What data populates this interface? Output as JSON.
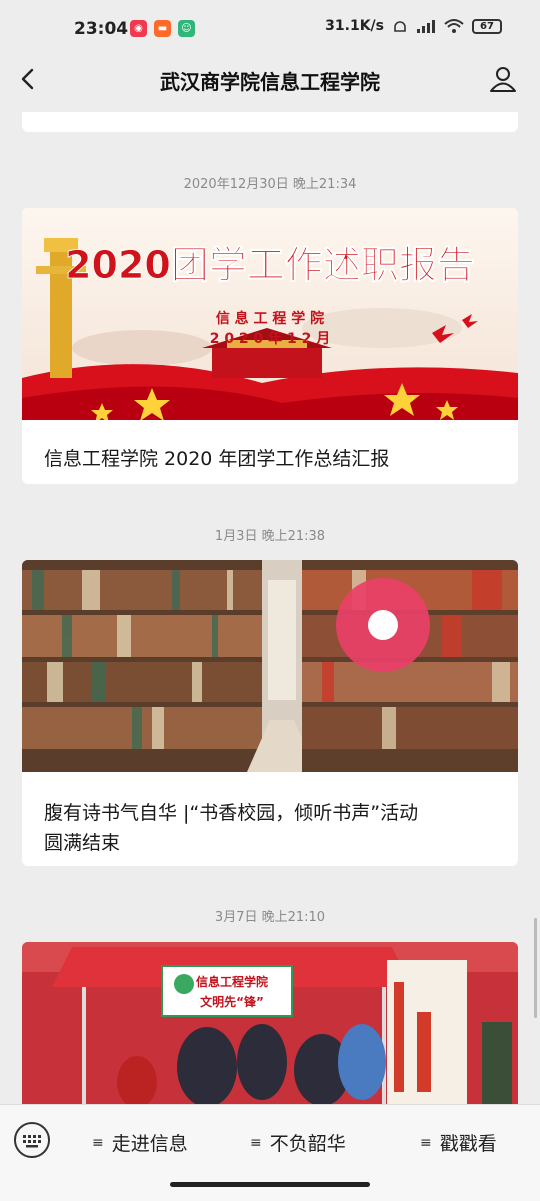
{
  "status": {
    "time": "23:04",
    "net_speed": "31.1K/s",
    "battery": "67",
    "apps": [
      {
        "icon": "app-red-icon",
        "color": "#f0394f"
      },
      {
        "icon": "app-orange-icon",
        "color": "#ff6a2a"
      },
      {
        "icon": "app-green-icon",
        "color": "#2db87a"
      }
    ]
  },
  "nav": {
    "title": "武汉商学院信息工程学院"
  },
  "articles": [
    {
      "time": "2020年12月30日 晚上21:34",
      "title": "信息工程学院 2020 年团学工作总结汇报",
      "banner": {
        "headline": "2020团学工作述职报告",
        "sub1": "信 息 工 程 学 院",
        "sub2": "2 0 2 0 年 1 2 月"
      }
    },
    {
      "time": "1月3日 晚上21:38",
      "title_line1": "腹有诗书气自华 |“书香校园，倾听书声”活动",
      "title_line2": "圆满结束"
    },
    {
      "time": "3月7日 晚上21:10",
      "sign1": "信息工程学院",
      "sign2": "文明先“锋”"
    }
  ],
  "menu": [
    {
      "label": "走进信息"
    },
    {
      "label": "不负韶华"
    },
    {
      "label": "戳戳看"
    }
  ]
}
